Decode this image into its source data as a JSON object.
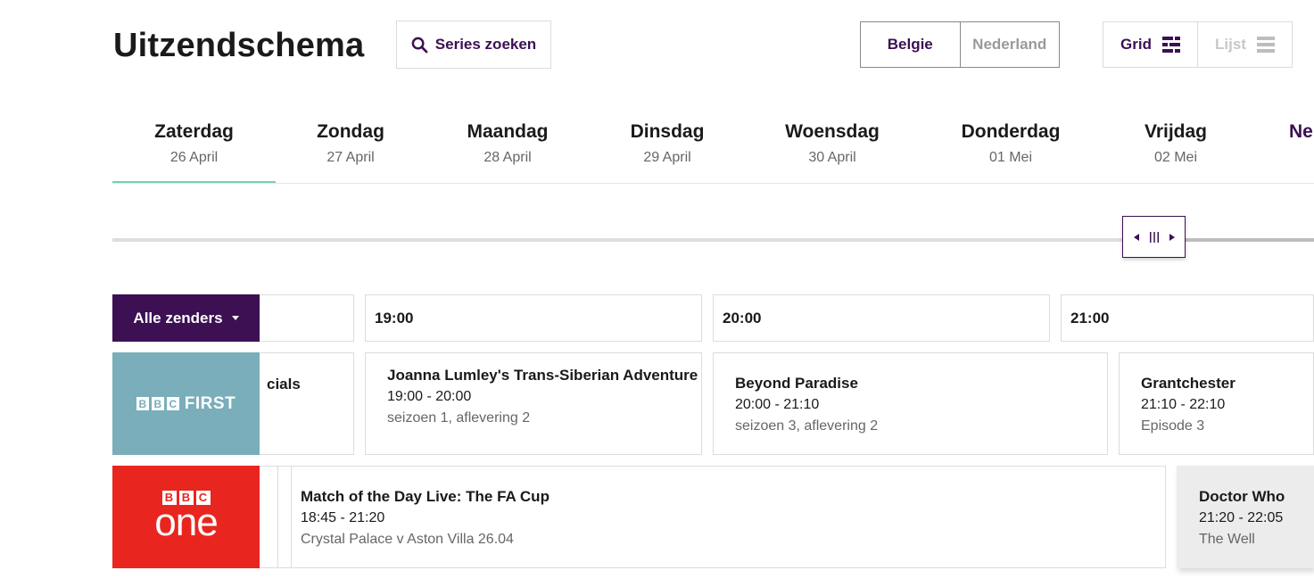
{
  "header": {
    "title": "Uitzendschema",
    "search_label": "Series zoeken",
    "country": {
      "active": "Belgie",
      "inactive": "Nederland"
    },
    "view": {
      "active": "Grid",
      "inactive": "Lijst"
    }
  },
  "days": [
    {
      "name": "Zaterdag",
      "date": "26 April"
    },
    {
      "name": "Zondag",
      "date": "27 April"
    },
    {
      "name": "Maandag",
      "date": "28 April"
    },
    {
      "name": "Dinsdag",
      "date": "29 April"
    },
    {
      "name": "Woensdag",
      "date": "30 April"
    },
    {
      "name": "Donderdag",
      "date": "01 Mei"
    },
    {
      "name": "Vrijdag",
      "date": "02 Mei"
    },
    {
      "name": "Ne"
    }
  ],
  "channels_button": "Alle zenders",
  "times": [
    "19:00",
    "20:00",
    "21:00"
  ],
  "channels": {
    "first": {
      "logo_letters": [
        "B",
        "B",
        "C"
      ],
      "logo_word": "FIRST"
    },
    "one": {
      "logo_letters": [
        "B",
        "B",
        "C"
      ],
      "logo_word": "one"
    }
  },
  "programs": {
    "first": [
      {
        "title": "cials"
      },
      {
        "title": "Joanna Lumley's Trans-Siberian Adventure",
        "time": "19:00 - 20:00",
        "sub": "seizoen 1, aflevering 2"
      },
      {
        "title": "Beyond Paradise",
        "time": "20:00 - 21:10",
        "sub": "seizoen 3, aflevering 2"
      },
      {
        "title": "Grantchester",
        "time": "21:10 - 22:10",
        "sub": "Episode 3"
      }
    ],
    "one": [
      {
        "title": "Match of the Day Live: The FA Cup",
        "time": "18:45 - 21:20",
        "sub": "Crystal Palace v Aston Villa 26.04"
      },
      {
        "title": "Doctor Who",
        "time": "21:20 - 22:05",
        "sub": "The Well"
      }
    ]
  }
}
